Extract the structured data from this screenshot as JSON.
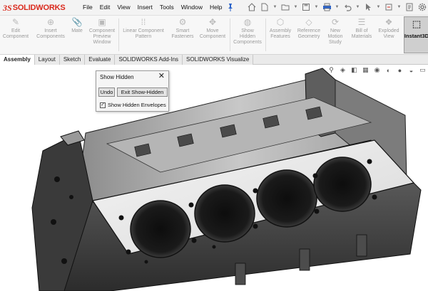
{
  "app": {
    "logo_mark": "3S",
    "logo_text": "SOLIDWORKS"
  },
  "menu": [
    "File",
    "Edit",
    "View",
    "Insert",
    "Tools",
    "Window",
    "Help"
  ],
  "quick_tools": [
    {
      "icon": "home-icon"
    },
    {
      "icon": "new-document-icon"
    },
    {
      "icon": "open-folder-icon"
    },
    {
      "icon": "save-icon"
    },
    {
      "icon": "print-icon"
    },
    {
      "icon": "undo-icon"
    },
    {
      "icon": "select-cursor-icon"
    },
    {
      "icon": "rebuild-icon"
    },
    {
      "icon": "file-properties-icon"
    },
    {
      "icon": "options-gear-icon"
    }
  ],
  "ribbon": {
    "commands": [
      {
        "label": "Edit\nComponent",
        "icon": "edit-component-icon"
      },
      {
        "label": "Insert\nComponents",
        "icon": "insert-components-icon"
      },
      {
        "label": "Mate",
        "icon": "mate-icon"
      },
      {
        "label": "Component\nPreview\nWindow",
        "icon": "component-preview-icon"
      },
      {
        "label": "Linear Component\nPattern",
        "icon": "linear-pattern-icon"
      },
      {
        "label": "Smart\nFasteners",
        "icon": "smart-fasteners-icon"
      },
      {
        "label": "Move\nComponent",
        "icon": "move-component-icon"
      },
      {
        "label": "Show\nHidden\nComponents",
        "icon": "show-hidden-icon"
      },
      {
        "label": "Assembly\nFeatures",
        "icon": "assembly-features-icon"
      },
      {
        "label": "Reference\nGeometry",
        "icon": "reference-geometry-icon"
      },
      {
        "label": "New\nMotion\nStudy",
        "icon": "motion-study-icon"
      },
      {
        "label": "Bill of\nMaterials",
        "icon": "bom-icon"
      },
      {
        "label": "Exploded\nView",
        "icon": "exploded-view-icon"
      }
    ],
    "instant3d": "Instant3D"
  },
  "tabs": [
    {
      "label": "Assembly",
      "active": true
    },
    {
      "label": "Layout",
      "active": false
    },
    {
      "label": "Sketch",
      "active": false
    },
    {
      "label": "Evaluate",
      "active": false
    },
    {
      "label": "SOLIDWORKS Add-Ins",
      "active": false
    },
    {
      "label": "SOLIDWORKS Visualize",
      "active": false
    }
  ],
  "dialog": {
    "title": "Show Hidden",
    "undo_label": "Undo",
    "exit_label": "Exit Show-Hidden",
    "checkbox_label": "Show Hidden Envelopes",
    "checkbox_checked": true,
    "checkmark": "✓"
  },
  "colors": {
    "brand": "#da291c",
    "pin": "#2a62c9"
  }
}
